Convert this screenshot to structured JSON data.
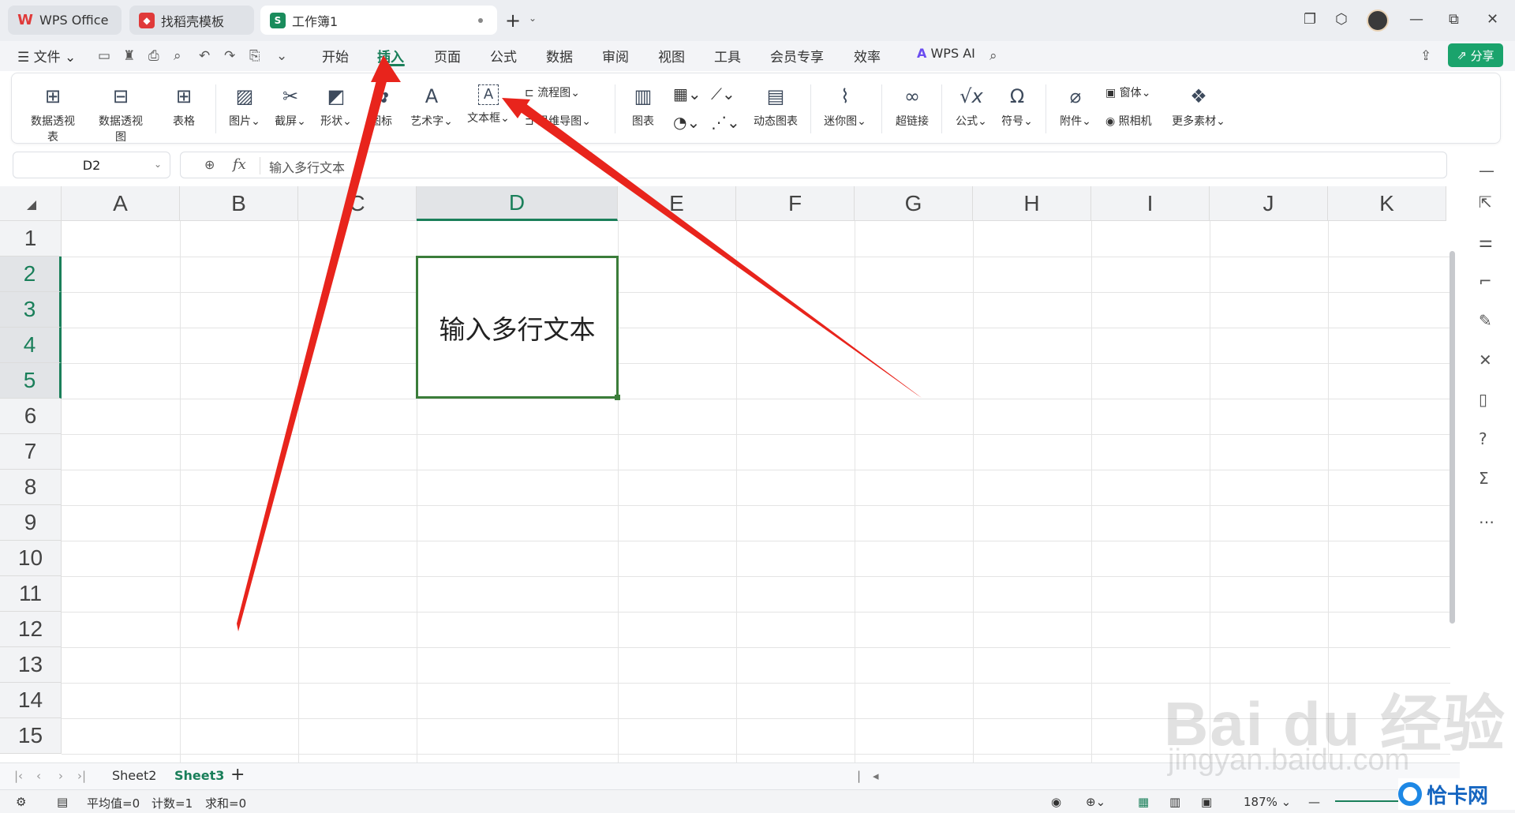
{
  "tabs": [
    {
      "label": "WPS Office",
      "icon": "wps-logo-icon",
      "color": "#e03a3a"
    },
    {
      "label": "找稻壳模板",
      "icon": "docer-icon",
      "color": "#e03a3a"
    },
    {
      "label": "工作簿1",
      "icon": "spreadsheet-icon",
      "color": "#1a8c5c",
      "active": true
    }
  ],
  "menubar": {
    "file_label": "文件",
    "items": [
      "开始",
      "插入",
      "页面",
      "公式",
      "数据",
      "审阅",
      "视图",
      "工具",
      "会员专享",
      "效率"
    ],
    "active": "插入",
    "wps_ai_label": "WPS AI",
    "share_label": "分享"
  },
  "ribbon": {
    "groups": [
      {
        "label": "数据透视表",
        "icon": "pivot-table-icon"
      },
      {
        "label": "数据透视图",
        "icon": "pivot-chart-icon"
      },
      {
        "label": "表格",
        "icon": "table-icon"
      },
      {
        "label": "图片",
        "icon": "picture-icon",
        "dropdown": true
      },
      {
        "label": "截屏",
        "icon": "screenshot-icon",
        "dropdown": true
      },
      {
        "label": "形状",
        "icon": "shapes-icon",
        "dropdown": true
      },
      {
        "label": "图标",
        "icon": "icons-icon"
      },
      {
        "label": "艺术字",
        "icon": "wordart-icon",
        "dropdown": true
      },
      {
        "label": "文本框",
        "icon": "textbox-icon",
        "dropdown": true
      },
      {
        "label": "图表",
        "icon": "chart-icon"
      },
      {
        "label": "动态图表",
        "icon": "dynamic-chart-icon"
      },
      {
        "label": "迷你图",
        "icon": "sparkline-icon",
        "dropdown": true
      },
      {
        "label": "超链接",
        "icon": "hyperlink-icon"
      },
      {
        "label": "公式",
        "icon": "formula-icon",
        "dropdown": true
      },
      {
        "label": "符号",
        "icon": "symbol-icon",
        "dropdown": true
      },
      {
        "label": "附件",
        "icon": "attachment-icon",
        "dropdown": true
      },
      {
        "label": "更多素材",
        "icon": "more-materials-icon",
        "dropdown": true
      }
    ],
    "small": {
      "flowchart": "流程图",
      "mindmap": "思维导图",
      "form": "窗体",
      "camera": "照相机"
    }
  },
  "formula_bar": {
    "name_box": "D2",
    "fx": "fx",
    "value": "输入多行文本"
  },
  "grid": {
    "columns": [
      "A",
      "B",
      "C",
      "D",
      "E",
      "F",
      "G",
      "H",
      "I",
      "J",
      "K"
    ],
    "rows": [
      "1",
      "2",
      "3",
      "4",
      "5",
      "6",
      "7",
      "8",
      "9",
      "10",
      "11",
      "12",
      "13",
      "14",
      "15"
    ],
    "selected_column": "D",
    "selected_rows": [
      "2",
      "3",
      "4",
      "5"
    ],
    "merged_cell_text": "输入多行文本"
  },
  "sheets": {
    "tabs": [
      "Sheet2",
      "Sheet3"
    ],
    "active": "Sheet3",
    "add_label": "+"
  },
  "status": {
    "average": "平均值=0",
    "count": "计数=1",
    "sum": "求和=0",
    "zoom": "187%"
  },
  "watermark": {
    "brand": "Bai du 经验",
    "url": "jingyan.baidu.com",
    "site": "恰卡网"
  },
  "colors": {
    "accent": "#1a7f5a",
    "arrow": "#e8241c",
    "share_button": "#1aa36c"
  }
}
